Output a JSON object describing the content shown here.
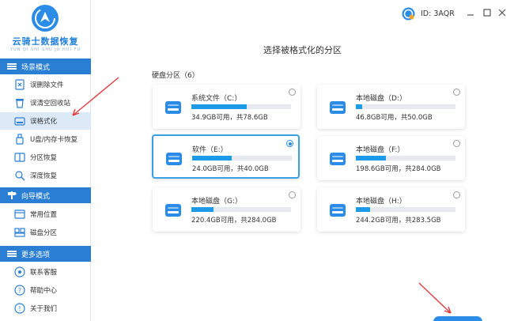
{
  "app": {
    "title": "云骑士数据恢复",
    "subtitle": "YUN QI SHI SHU JU HUI FU"
  },
  "topbar": {
    "user_id": "ID: 3AQR"
  },
  "sidebar": {
    "sections": [
      {
        "title": "场景模式",
        "items": [
          {
            "label": "误删除文件",
            "icon": "file-delete-icon"
          },
          {
            "label": "误清空回收站",
            "icon": "recycle-bin-icon"
          },
          {
            "label": "误格式化",
            "icon": "format-disk-icon",
            "active": true
          },
          {
            "label": "U盘/内存卡恢复",
            "icon": "usb-drive-icon"
          },
          {
            "label": "分区恢复",
            "icon": "partition-icon"
          },
          {
            "label": "深度恢复",
            "icon": "deep-scan-icon"
          }
        ]
      },
      {
        "title": "向导模式",
        "items": [
          {
            "label": "常用位置",
            "icon": "location-icon"
          },
          {
            "label": "磁盘分区",
            "icon": "disk-partition-icon"
          }
        ]
      },
      {
        "title": "更多选项",
        "items": [
          {
            "label": "联系客服",
            "icon": "headset-icon"
          },
          {
            "label": "帮助中心",
            "icon": "help-icon"
          },
          {
            "label": "关于我们",
            "icon": "info-icon"
          }
        ]
      }
    ]
  },
  "main": {
    "heading": "选择被格式化的分区",
    "group_label": "硬盘分区（6）",
    "partitions": [
      {
        "name": "系统文件（C:）",
        "info": "34.9GB可用，共78.6GB",
        "used_fraction": 0.556,
        "selected": false
      },
      {
        "name": "本地磁盘（D:）",
        "info": "46.8GB可用，共50.0GB",
        "used_fraction": 0.064,
        "selected": false
      },
      {
        "name": "软件（E:）",
        "info": "24.0GB可用，共40.0GB",
        "used_fraction": 0.4,
        "selected": true
      },
      {
        "name": "本地磁盘（F:）",
        "info": "198.6GB可用，共284.0GB",
        "used_fraction": 0.3,
        "selected": false
      },
      {
        "name": "本地磁盘（G:）",
        "info": "220.4GB可用，共284.0GB",
        "used_fraction": 0.224,
        "selected": false
      },
      {
        "name": "本地磁盘（H:）",
        "info": "244.2GB可用，共283.5GB",
        "used_fraction": 0.139,
        "selected": false
      }
    ]
  },
  "colors": {
    "accent": "#2a7fd4",
    "progress": "#1e9be8",
    "selected_border": "#3aa0e6",
    "annotation_arrow": "#e03c3c"
  }
}
